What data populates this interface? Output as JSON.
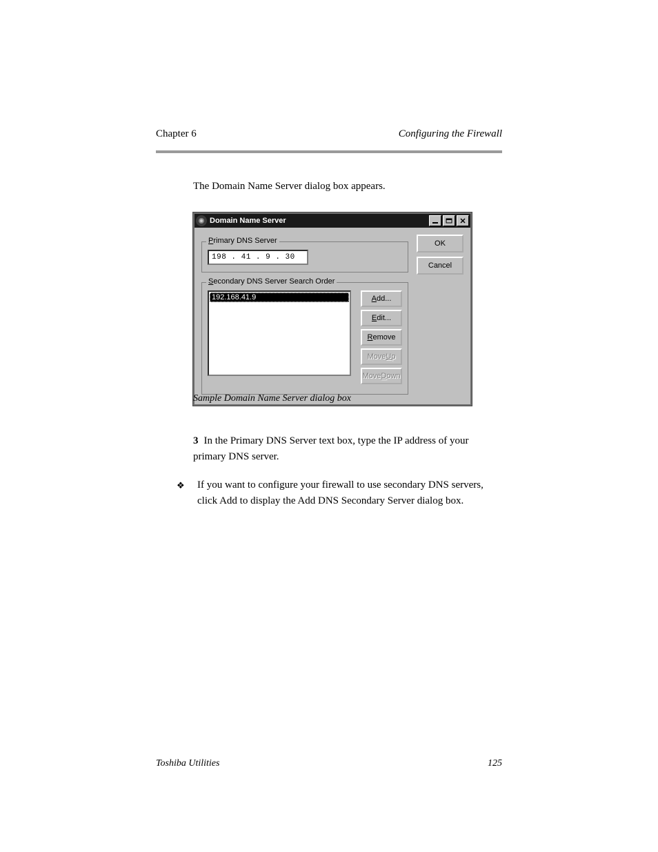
{
  "header": {
    "chapter_label": "Chapter 6",
    "chapter_title_italic": "Configuring the Firewall"
  },
  "intro_text": "The Domain Name Server dialog box appears.",
  "dialog": {
    "title": "Domain Name Server",
    "primary_group_label_prefix": "P",
    "primary_group_label_rest": "rimary DNS Server",
    "primary_ip": "198 . 41  .  9  . 30",
    "secondary_group_label_prefix": "S",
    "secondary_group_label_rest": "econdary DNS Server Search Order",
    "secondary_selected": "192.168.41.9",
    "buttons": {
      "add_prefix": "A",
      "add_rest": "dd...",
      "edit_prefix": "E",
      "edit_rest": "dit...",
      "remove_prefix": "R",
      "remove_rest": "emove",
      "moveup_prefix": "U",
      "moveup_pre": "Move ",
      "moveup_rest": "p",
      "movedown_prefix": "D",
      "movedown_pre": "Move ",
      "movedown_rest": "own",
      "ok": "OK",
      "cancel": "Cancel"
    }
  },
  "caption": "Sample Domain Name Server dialog box",
  "instruction": "In the Primary DNS Server text box, type the IP address of your primary DNS server.",
  "bullet": "If you want to configure your firewall to use secondary DNS servers, click Add to display the Add DNS Secondary Server dialog box.",
  "footer": {
    "left": "Toshiba Utilities",
    "right": "125"
  }
}
